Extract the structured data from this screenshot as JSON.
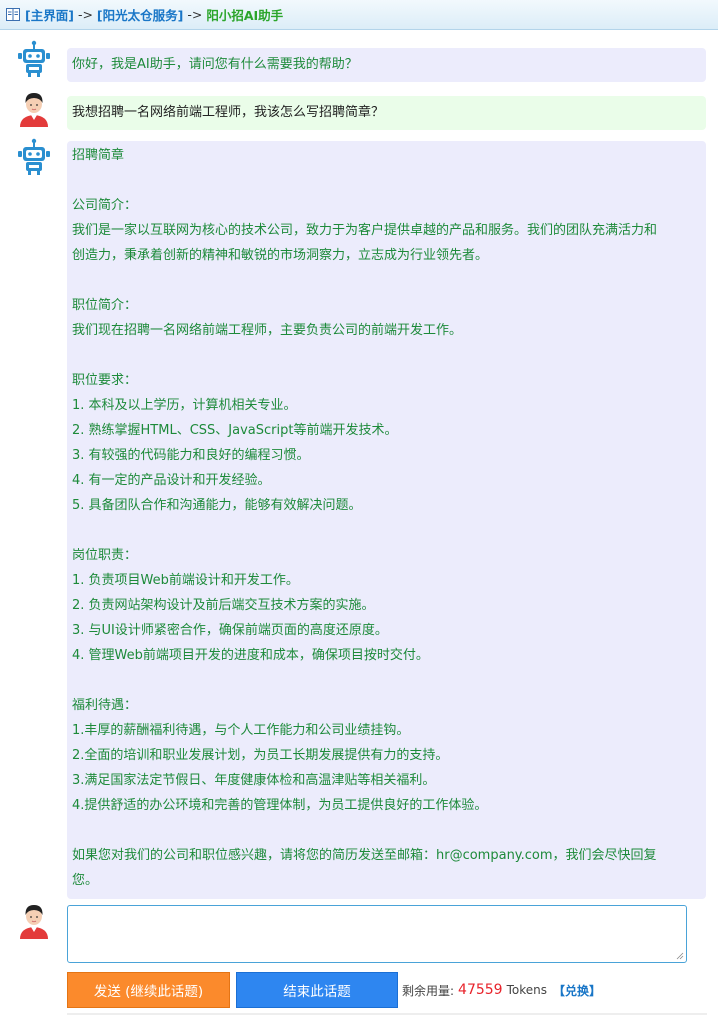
{
  "breadcrumb": {
    "home": "[主界面]",
    "service": "[阳光太仓服务]",
    "current": "阳小招AI助手",
    "separator": "->"
  },
  "messages": [
    {
      "role": "ai",
      "avatar_icon": "robot-icon",
      "lines": [
        "你好，我是AI助手，请问您有什么需要我的帮助？"
      ]
    },
    {
      "role": "user",
      "avatar_icon": "user-avatar-icon",
      "lines": [
        "我想招聘一名网络前端工程师，我该怎么写招聘简章？"
      ]
    },
    {
      "role": "ai",
      "avatar_icon": "robot-icon",
      "lines": [
        "招聘简章",
        "",
        "公司简介：",
        "我们是一家以互联网为核心的技术公司，致力于为客户提供卓越的产品和服务。我们的团队充满活力和",
        "创造力，秉承着创新的精神和敏锐的市场洞察力，立志成为行业领先者。",
        "",
        "职位简介：",
        "我们现在招聘一名网络前端工程师，主要负责公司的前端开发工作。",
        "",
        "职位要求：",
        "1. 本科及以上学历，计算机相关专业。",
        "2. 熟练掌握HTML、CSS、JavaScript等前端开发技术。",
        "3. 有较强的代码能力和良好的编程习惯。",
        "4. 有一定的产品设计和开发经验。",
        "5. 具备团队合作和沟通能力，能够有效解决问题。",
        "",
        "岗位职责：",
        "1. 负责项目Web前端设计和开发工作。",
        "2. 负责网站架构设计及前后端交互技术方案的实施。",
        "3. 与UI设计师紧密合作，确保前端页面的高度还原度。",
        "4. 管理Web前端项目开发的进度和成本，确保项目按时交付。",
        "",
        "福利待遇：",
        "1.丰厚的薪酬福利待遇，与个人工作能力和公司业绩挂钩。",
        "2.全面的培训和职业发展计划，为员工长期发展提供有力的支持。",
        "3.满足国家法定节假日、年度健康体检和高温津贴等相关福利。",
        "4.提供舒适的办公环境和完善的管理体制，为员工提供良好的工作体验。",
        "",
        "如果您对我们的公司和职位感兴趣，请将您的简历发送至邮箱：hr@company.com，我们会尽快回复",
        "您。"
      ]
    }
  ],
  "input": {
    "value": "",
    "placeholder": ""
  },
  "buttons": {
    "send": "发送 (继续此话题)",
    "end": "结束此话题"
  },
  "usage": {
    "label": "剩余用量:",
    "value": "47559",
    "unit": "Tokens",
    "exchange": "【兑换】"
  },
  "colors": {
    "ai_bubble": "#ececfc",
    "user_bubble": "#eafde9",
    "ai_text": "#1d8a3a",
    "send": "#fb8a2c",
    "end": "#2e86f0",
    "tokens": "#e8232b"
  }
}
